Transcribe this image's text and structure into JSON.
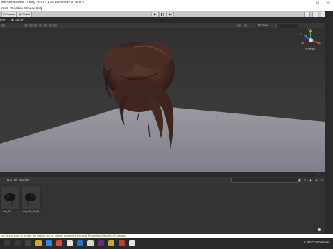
{
  "window": {
    "title": "ws Standalone - Unity 2020.3.47f1 Personal* <DX11>",
    "controls": [
      "—",
      "☐",
      "✕"
    ]
  },
  "menu": [
    "nent",
    "Rendition",
    "Window",
    "Help"
  ],
  "toolbar": {
    "center_label": "Center",
    "global_label": "Global",
    "play": "▶",
    "pause": "❚❚",
    "step": "▶|"
  },
  "tabs": {
    "scene": "ene",
    "game": "Game"
  },
  "scene_toolbar": {
    "gizmos_label": "Gizmos"
  },
  "gizmo": {
    "x": "x",
    "y": "y",
    "z": "z",
    "persp": "< Persp"
  },
  "project": {
    "breadcrumb_1": "Hair All",
    "breadcrumb_2": "Prefabs",
    "search_placeholder": "",
    "counter": "29",
    "assets": [
      {
        "label": "hair_00"
      },
      {
        "label": "hair_00_Scroll"
      }
    ]
  },
  "status": {
    "message": "ply. If you want to render the default gui for shader properties then call PropertiesDefaultGUI() instead."
  },
  "taskbar": {
    "temperature": "32°C",
    "weather": "Sabetotes"
  },
  "colors": {
    "accent": "#4a7bd4",
    "hair": "#4b2e26",
    "plane": "#8e8f98"
  }
}
